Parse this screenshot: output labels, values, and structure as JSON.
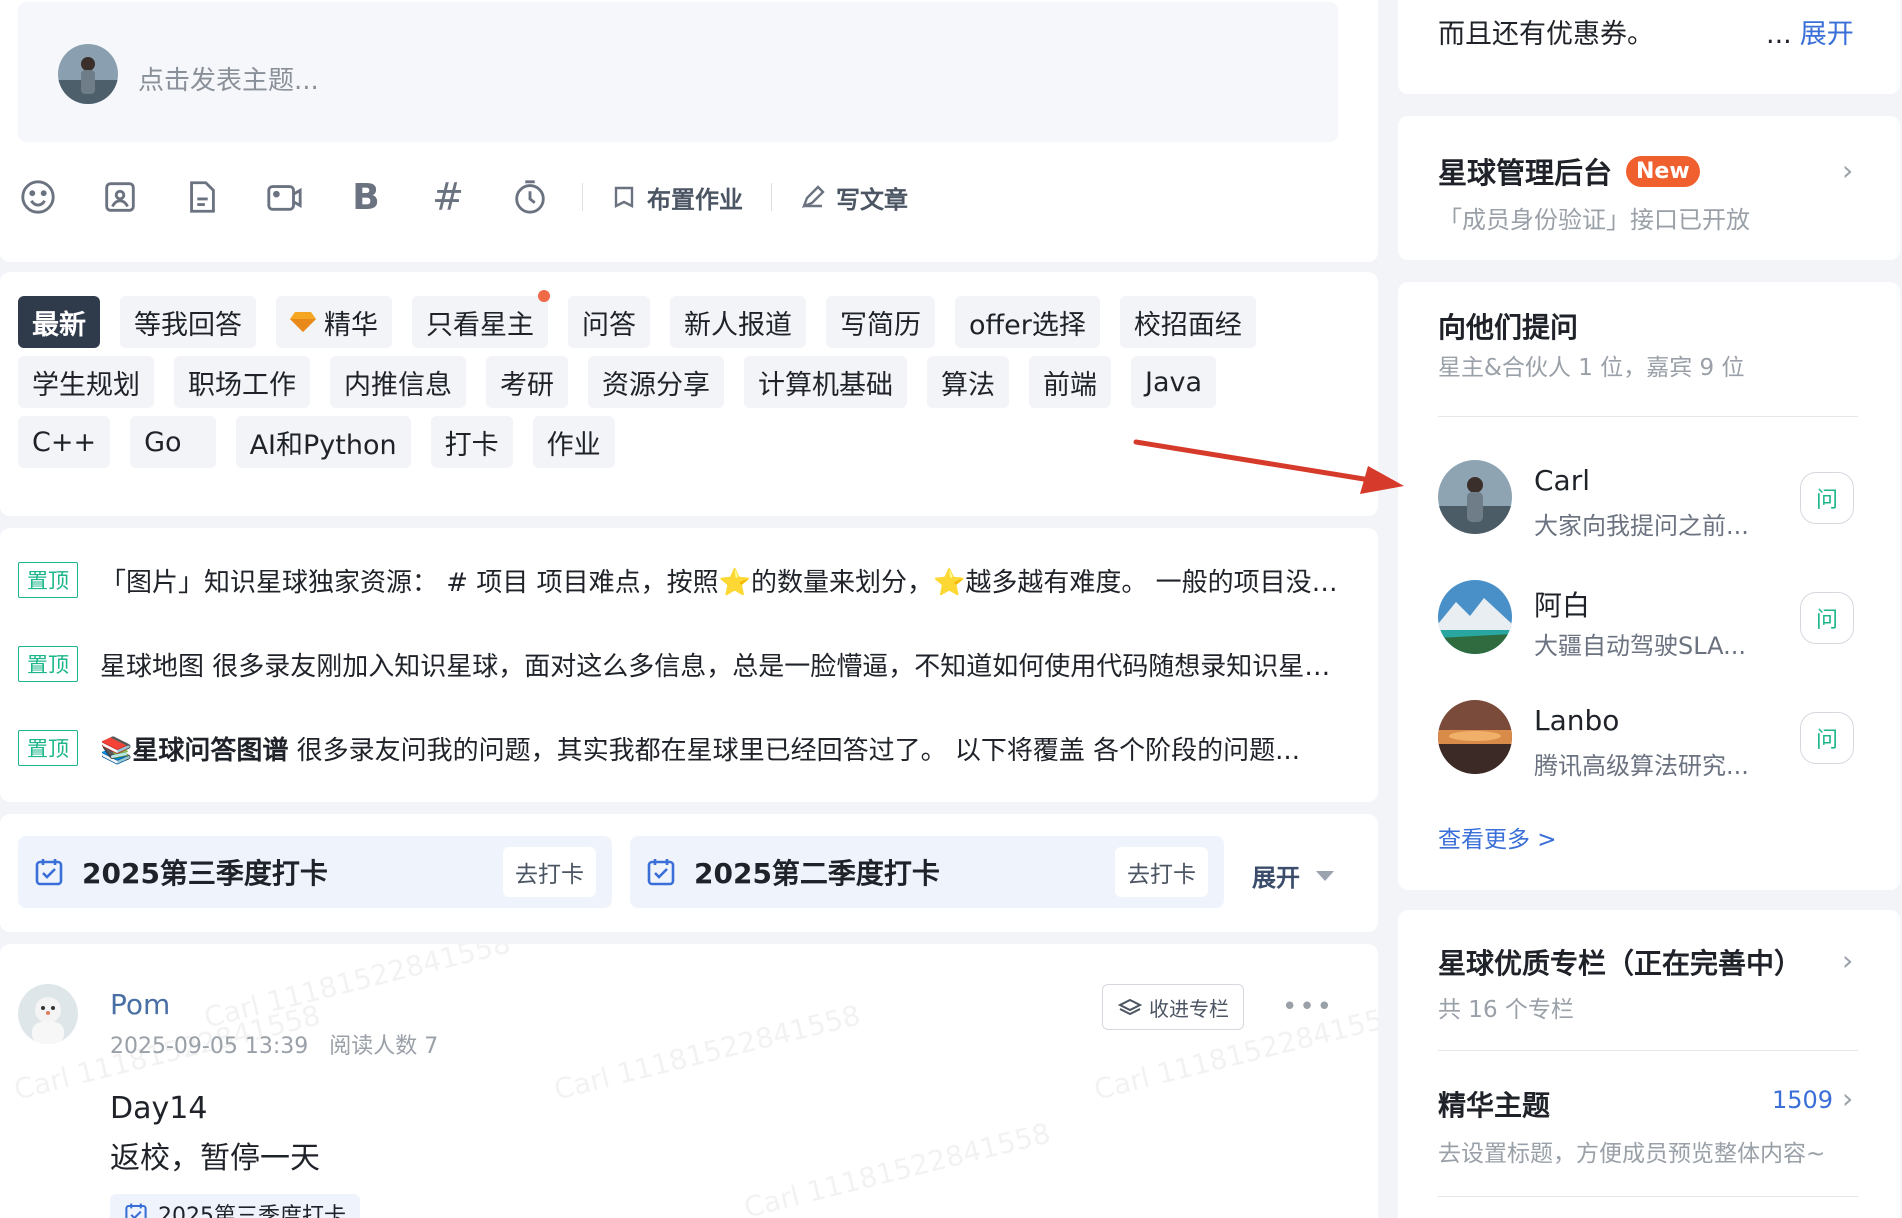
{
  "composer": {
    "placeholder": "点击发表主题...",
    "assign_homework": "布置作业",
    "write_article": "写文章",
    "bold_label": "B",
    "hash_label": "#"
  },
  "tags": {
    "row1": [
      "最新",
      "等我回答",
      "精华",
      "只看星主",
      "问答",
      "新人报道",
      "写简历",
      "offer选择",
      "校招面经"
    ],
    "row2": [
      "学生规划",
      "职场工作",
      "内推信息",
      "考研",
      "资源分享",
      "计算机基础",
      "算法",
      "前端",
      "Java"
    ],
    "row3": [
      "C++",
      "Go",
      "AI和Python",
      "打卡",
      "作业"
    ]
  },
  "pinned": {
    "badge": "置顶",
    "items": [
      {
        "bold": "",
        "text": "「图片」知识星球独家资源： # 项目 项目难点，按照⭐的数量来划分，⭐越多越有难度。 一般的项目没有什么特别难点..."
      },
      {
        "bold": "",
        "text": "星球地图 很多录友刚加入知识星球，面对这么多信息，总是一脸懵逼，不知道如何使用代码随想录知识星球..."
      },
      {
        "bold": "📚星球问答图谱",
        "text": " 很多录友问我的问题，其实我都在星球里已经回答过了。 以下将覆盖 各个阶段的问题..."
      }
    ]
  },
  "checkin": {
    "items": [
      {
        "title": "2025第三季度打卡",
        "button": "去打卡"
      },
      {
        "title": "2025第二季度打卡",
        "button": "去打卡"
      }
    ],
    "expand": "展开"
  },
  "post": {
    "author": "Pom",
    "date": "2025-09-05 13:39",
    "reads": "阅读人数 7",
    "collect": "收进专栏",
    "more": "•••",
    "line1": "Day14",
    "line2": "返校，暂停一天",
    "tag": "2025第三季度打卡",
    "watermarks": [
      "Carl 11181522841558",
      "Carl 11181522841558",
      "Carl 11181522841558",
      "Carl 11181522841558",
      "Carl 11181522841558"
    ]
  },
  "sidebar": {
    "intro_text": "而且还有优惠券。",
    "intro_ellipsis": "...",
    "intro_expand": "展开",
    "admin_title": "星球管理后台",
    "admin_badge": "New",
    "admin_sub": "「成员身份验证」接口已开放",
    "ask_title": "向他们提问",
    "ask_sub": "星主&合伙人 1 位，嘉宾 9 位",
    "ask_button": "问",
    "people": [
      {
        "name": "Carl",
        "desc": "大家向我提问之前..."
      },
      {
        "name": "阿白",
        "desc": "大疆自动驾驶SLA..."
      },
      {
        "name": "Lanbo",
        "desc": "腾讯高级算法研究..."
      }
    ],
    "see_more": "查看更多 >",
    "columns_title": "星球优质专栏（正在完善中）",
    "columns_sub": "共 16 个专栏",
    "essence_title": "精华主题",
    "essence_count": "1509",
    "essence_sub": "去设置标题，方便成员预览整体内容~"
  },
  "colors": {
    "accent_green": "#1db58a",
    "link_blue": "#3a6fd8",
    "active_tag": "#2f3a4b",
    "new_badge": "#f0602f",
    "annotation_red": "#d63a2a"
  }
}
